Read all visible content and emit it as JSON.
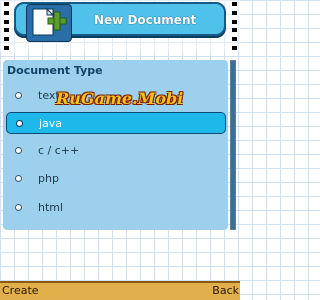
{
  "window": {
    "title": "New Document"
  },
  "panel": {
    "heading": "Document Type"
  },
  "options": [
    {
      "label": "text",
      "selected": false
    },
    {
      "label": "java",
      "selected": true
    },
    {
      "label": "c / c++",
      "selected": false
    },
    {
      "label": "php",
      "selected": false
    },
    {
      "label": "html",
      "selected": false
    }
  ],
  "watermark": "RuGame.Mobi",
  "softkeys": {
    "left": "Create",
    "right": "Back"
  },
  "icons": {
    "title": "new-document-icon",
    "option_marker": "radio-dot-icon"
  },
  "colors": {
    "title_bar": "#4fc1ea",
    "panel": "#9dd0ec",
    "selection": "#1fb8ea",
    "softkey_bar": "#e2b04a",
    "watermark": "#f6c21e"
  }
}
